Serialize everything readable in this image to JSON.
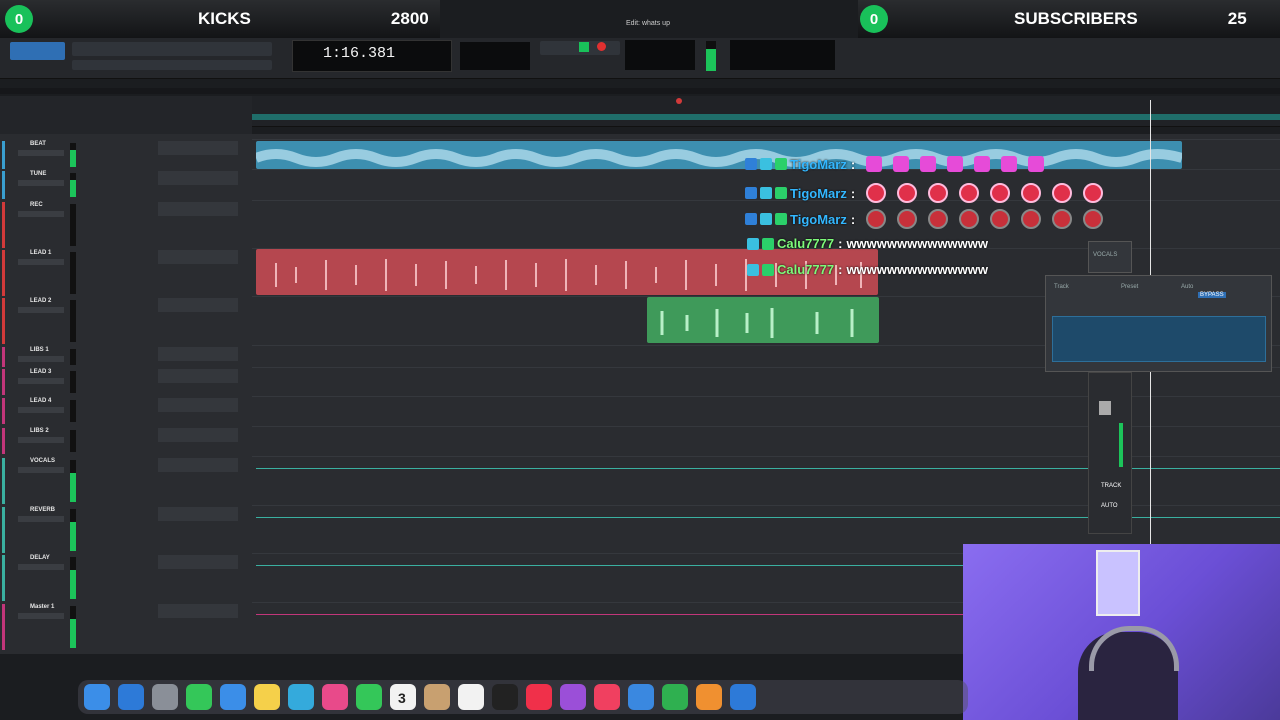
{
  "overlay": {
    "left_count": "0",
    "left_label": "KICKS",
    "left_value": "2800",
    "right_count": "0",
    "right_label": "SUBSCRIBERS",
    "right_value": "25"
  },
  "window": {
    "title": "Edit: whats up"
  },
  "transport": {
    "counter": "1:16.381"
  },
  "colors": {
    "accent_green": "#19c15a",
    "clip_blue": "#3d8fb0",
    "clip_red": "#b5474f",
    "clip_green": "#3f9a5a"
  },
  "tracks": [
    {
      "name": "BEAT",
      "color": "#3a9fd0"
    },
    {
      "name": "TUNE",
      "color": "#3a9fd0"
    },
    {
      "name": "REC",
      "color": "#d23a3a"
    },
    {
      "name": "LEAD 1",
      "color": "#d23a3a"
    },
    {
      "name": "LEAD 2",
      "color": "#d23a3a"
    },
    {
      "name": "LIBS 1",
      "color": "#c2367a"
    },
    {
      "name": "LEAD 3",
      "color": "#c2367a"
    },
    {
      "name": "LEAD 4",
      "color": "#c2367a"
    },
    {
      "name": "LIBS 2",
      "color": "#c2367a"
    },
    {
      "name": "VOCALS",
      "color": "#3ab0a0"
    },
    {
      "name": "REVERB",
      "color": "#3ab0a0"
    },
    {
      "name": "DELAY",
      "color": "#3ab0a0"
    },
    {
      "name": "Master 1",
      "color": "#c2367a"
    }
  ],
  "chat": [
    {
      "user": "TigoMarz",
      "message": "",
      "emotes": "pink",
      "name_color": "blue"
    },
    {
      "user": "TigoMarz",
      "message": "",
      "emotes": "red",
      "name_color": "blue"
    },
    {
      "user": "TigoMarz",
      "message": "",
      "emotes": "face",
      "name_color": "blue"
    },
    {
      "user": "Calu7777",
      "message": "wwwwwwwwwwwwww",
      "name_color": "green"
    },
    {
      "user": "Calu7777",
      "message": "wwwwwwwwwwwwww",
      "name_color": "green"
    }
  ],
  "plugin": {
    "track_label": "Track",
    "preset_label": "Preset",
    "auto_label": "Auto",
    "bypass": "BYPASS",
    "tab": "VOCALS",
    "fader_track": "TRACK",
    "fader_auto": "AUTO"
  },
  "dock": {
    "calendar_day": "3"
  },
  "icons": [
    "finder-icon",
    "safari-icon",
    "launchpad-icon",
    "messages-icon",
    "mail-icon",
    "notes-icon",
    "photos-icon",
    "facetime-icon",
    "calendar-icon",
    "appletv-icon",
    "music-icon",
    "podcasts-icon",
    "news-icon",
    "keynote-icon",
    "numbers-icon",
    "pages-icon",
    "appstore-icon",
    "settings-icon",
    "ilok-icon",
    "protools-icon"
  ]
}
